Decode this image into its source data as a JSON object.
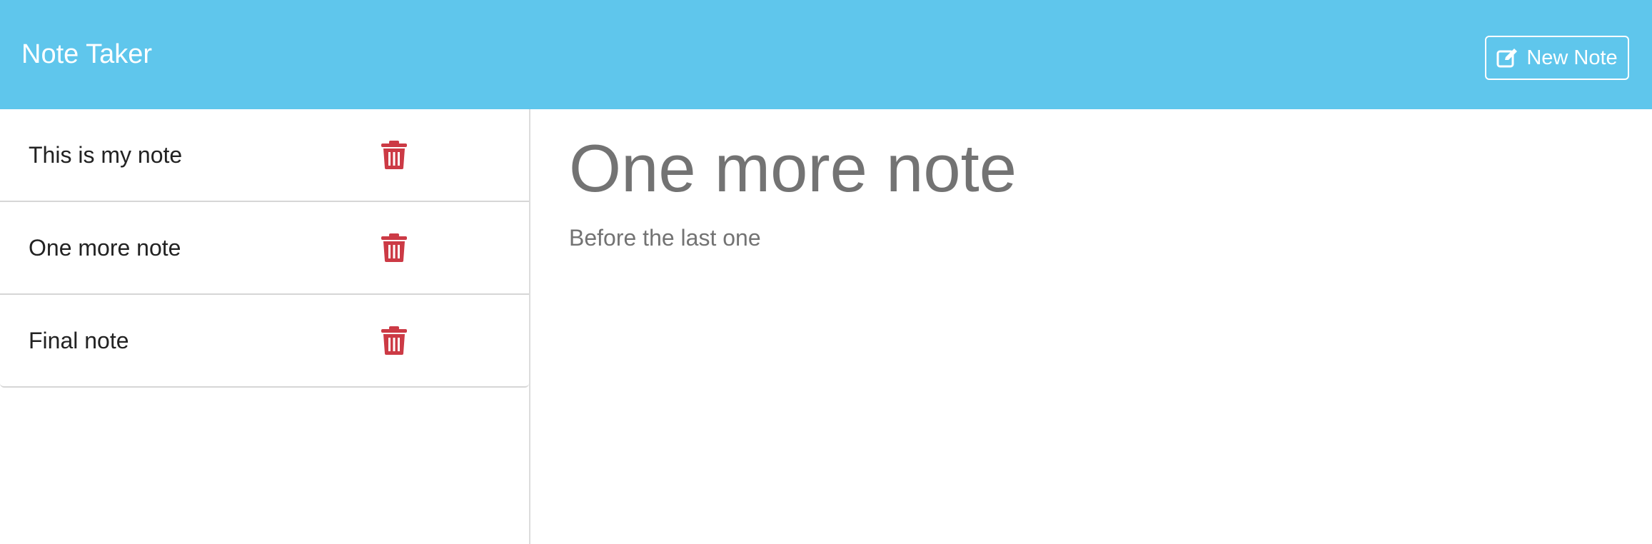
{
  "navbar": {
    "brand": "Note Taker",
    "new_note_label": "New Note",
    "new_note_icon": "edit-icon",
    "background": "#5fc6ec"
  },
  "notes": [
    {
      "title": "This is my note"
    },
    {
      "title": "One more note"
    },
    {
      "title": "Final note"
    }
  ],
  "delete_icon": "trash-icon",
  "delete_color": "#cc3a45",
  "active_note": {
    "title": "One more note",
    "text": "Before the last one"
  }
}
